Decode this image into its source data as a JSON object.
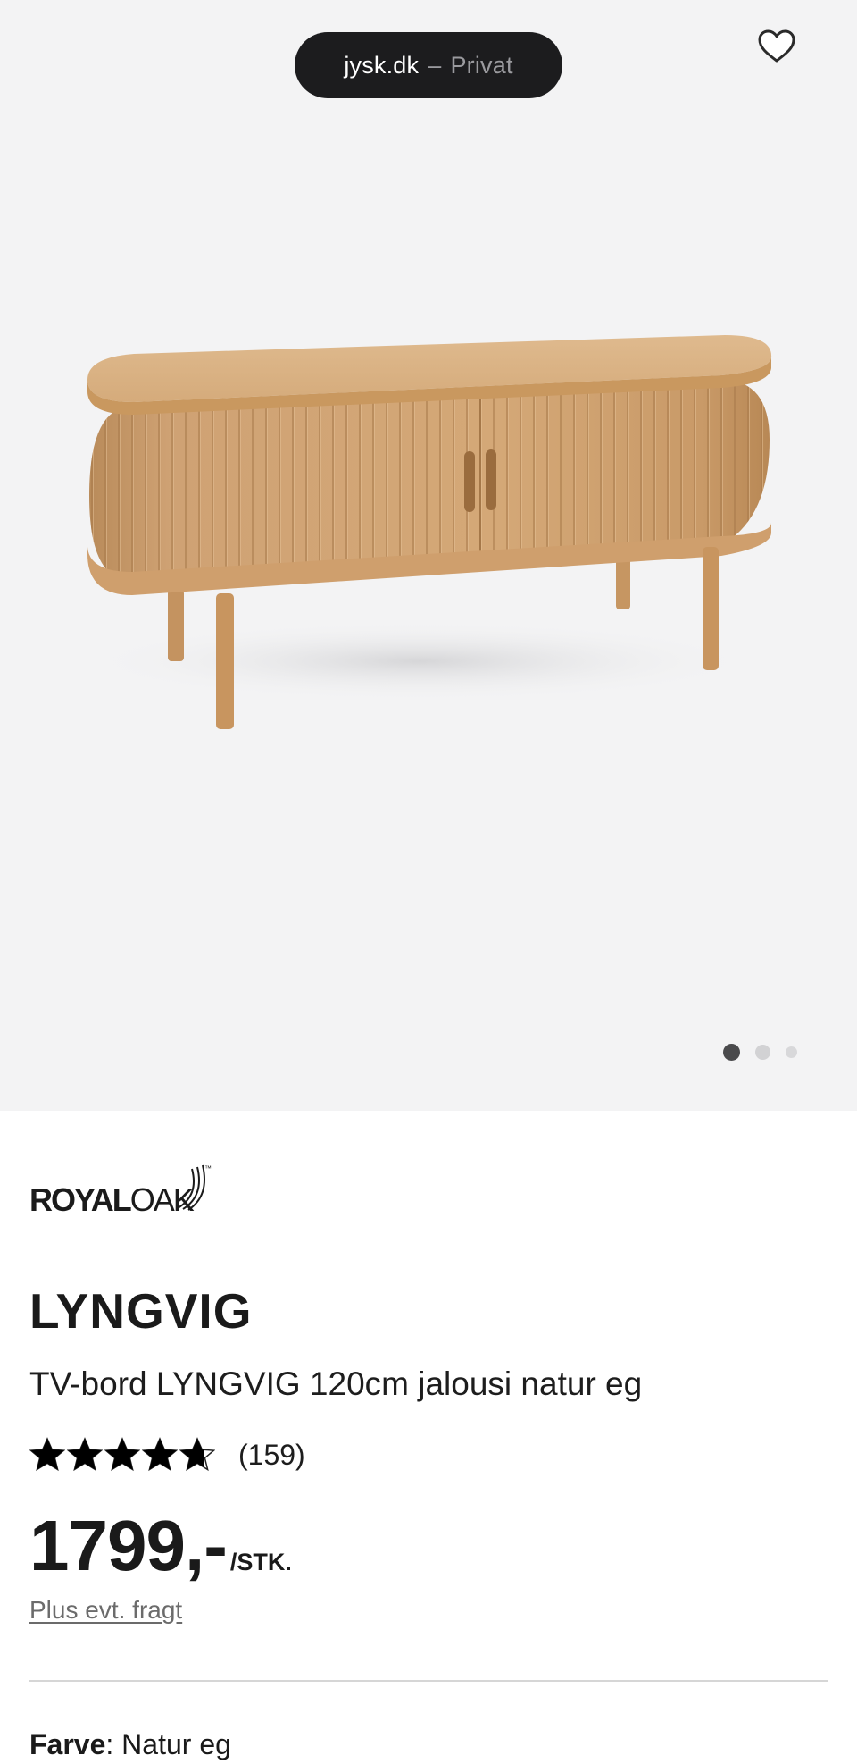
{
  "browser": {
    "domain": "jysk.dk",
    "separator": "–",
    "mode": "Privat"
  },
  "gallery": {
    "image_alt": "TV-bord LYNGVIG 120cm jalousi natur eg",
    "slide_count": 3,
    "active_slide": 1
  },
  "brand": {
    "logo_part1": "ROYAL",
    "logo_part2": "OAK",
    "trademark": "™"
  },
  "product": {
    "name": "LYNGVIG",
    "description": "TV-bord LYNGVIG 120cm jalousi natur eg",
    "rating": 4.7,
    "rating_max": 5,
    "review_count": "(159)",
    "price": "1799,-",
    "price_unit": "/STK.",
    "shipping_note": "Plus evt. fragt",
    "color_label": "Farve",
    "color_separator": ":",
    "color_value": "Natur eg"
  },
  "colors": {
    "hero_bg": "#f3f3f4",
    "pill_bg": "#1c1c1e",
    "wood": "#d4a877",
    "star": "#000000"
  },
  "icons": {
    "favorite": "heart-icon",
    "rating": "star-icon"
  }
}
